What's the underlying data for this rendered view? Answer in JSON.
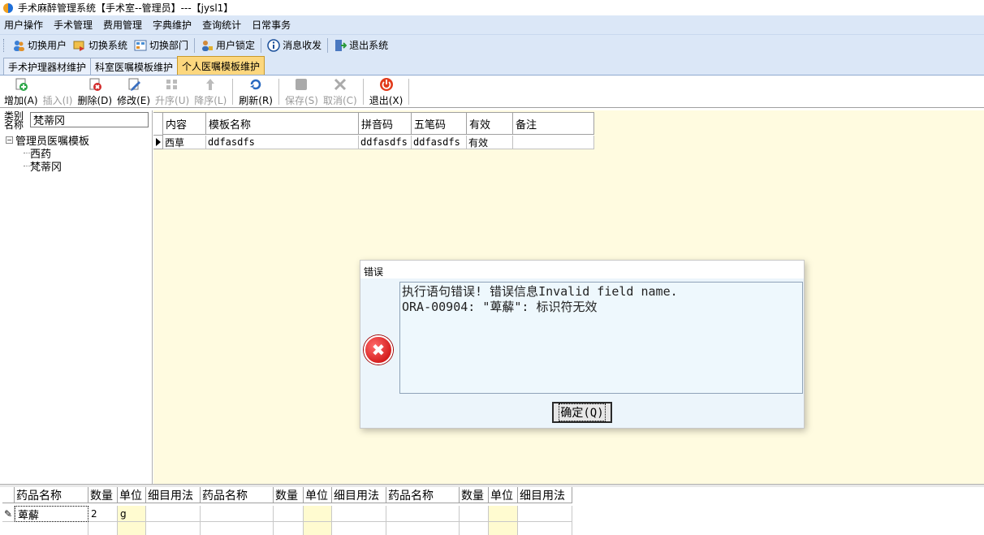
{
  "window": {
    "title": "手术麻醉管理系统【手术室--管理员】---【jysl1】"
  },
  "menu": [
    "用户操作",
    "手术管理",
    "费用管理",
    "字典维护",
    "查询统计",
    "日常事务"
  ],
  "toolbar": [
    {
      "label": "切换用户",
      "icon": "users-icon"
    },
    {
      "label": "切换系统",
      "icon": "switch-system-icon"
    },
    {
      "label": "切换部门",
      "icon": "department-icon"
    },
    {
      "label": "用户锁定",
      "icon": "user-lock-icon"
    },
    {
      "label": "消息收发",
      "icon": "info-icon"
    },
    {
      "label": "退出系统",
      "icon": "exit-door-icon"
    }
  ],
  "tabs": [
    "手术护理器材维护",
    "科室医嘱模板维护",
    "个人医嘱模板维护"
  ],
  "active_tab": "个人医嘱模板维护",
  "ops": [
    {
      "label": "增加(A)",
      "icon": "add-icon",
      "enabled": true
    },
    {
      "label": "插入(I)",
      "icon": "insert-icon",
      "enabled": false
    },
    {
      "label": "删除(D)",
      "icon": "delete-icon",
      "enabled": true
    },
    {
      "label": "修改(E)",
      "icon": "edit-icon",
      "enabled": true
    },
    {
      "label": "升序(U)",
      "icon": "sort-up-icon",
      "enabled": false
    },
    {
      "label": "降序(L)",
      "icon": "sort-down-icon",
      "enabled": false
    },
    {
      "label": "刷新(R)",
      "icon": "refresh-icon",
      "enabled": true
    },
    {
      "label": "保存(S)",
      "icon": "save-icon",
      "enabled": false
    },
    {
      "label": "取消(C)",
      "icon": "cancel-icon",
      "enabled": false
    },
    {
      "label": "退出(X)",
      "icon": "power-icon",
      "enabled": true
    }
  ],
  "category": {
    "label": "类别名称",
    "value": "梵蒂冈"
  },
  "tree": {
    "root": "管理员医嘱模板",
    "children": [
      "西药",
      "梵蒂冈"
    ]
  },
  "template_grid": {
    "headers": [
      "内容",
      "模板名称",
      "拼音码",
      "五笔码",
      "有效",
      "备注"
    ],
    "rows": [
      [
        "西草",
        "ddfasdfs",
        "ddfasdfs",
        "ddfasdfs",
        "有效",
        ""
      ]
    ]
  },
  "detail_grid": {
    "headers": [
      "药品名称",
      "数量",
      "单位",
      "细目用法",
      "药品名称",
      "数量",
      "单位",
      "细目用法",
      "药品名称",
      "数量",
      "单位",
      "细目用法"
    ],
    "rows": [
      [
        "萆薢",
        "2",
        "g",
        "",
        "",
        "",
        "",
        "",
        "",
        "",
        "",
        ""
      ]
    ]
  },
  "dialog": {
    "title": "错误",
    "message": "执行语句错误! 错误信息Invalid field name.\nORA-00904: \"萆薢\": 标识符无效",
    "ok_label": "确定(Q)"
  }
}
